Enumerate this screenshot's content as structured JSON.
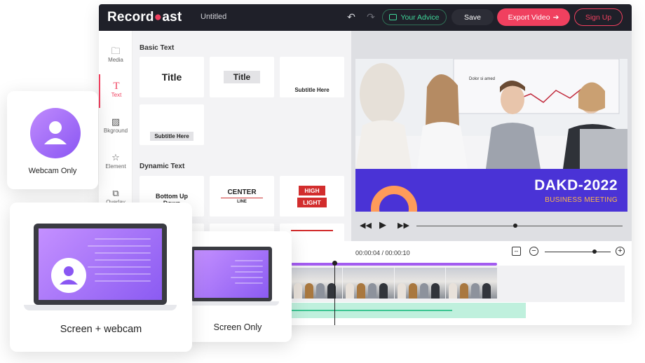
{
  "app": {
    "logo_text_1": "Record",
    "logo_text_2": "ast",
    "doc_title": "Untitled",
    "advice_label": "Your Advice",
    "save_label": "Save",
    "export_label": "Export Video",
    "signup_label": "Sign Up",
    "colors": {
      "accent": "#f0405f",
      "advice": "#3fd79a",
      "purple": "#8a56f3",
      "banner": "#4a33d6"
    }
  },
  "rail": [
    {
      "label": "Media",
      "icon": "folder-icon"
    },
    {
      "label": "Text",
      "icon": "text-icon"
    },
    {
      "label": "Bkground",
      "icon": "image-icon"
    },
    {
      "label": "Element",
      "icon": "star-icon"
    },
    {
      "label": "Overlay",
      "icon": "overlay-icon"
    }
  ],
  "panel": {
    "basic_title": "Basic Text",
    "basic": [
      "Title",
      "Title",
      "Subtitle Here",
      "Subtitle Here"
    ],
    "dynamic_title": "Dynamic Text",
    "dynamic_1": "Bottom Up",
    "dynamic_1b": "Down",
    "dynamic_2": "CENTER",
    "dynamic_2b": "LINE",
    "dynamic_3a": "HIGH",
    "dynamic_3b": "LIGHT"
  },
  "preview": {
    "banner_title": "DAKD-2022",
    "banner_sub": "BUSINESS MEETING",
    "whiteboard_text": "Dolor si amed",
    "seek_progress": 0.48
  },
  "timeline": {
    "timecode": "00:00:04 / 00:00:10",
    "zoom_level": 0.75
  },
  "cards": {
    "webcam_only": "Webcam Only",
    "screen_webcam": "Screen + webcam",
    "screen_only": "Screen Only"
  }
}
